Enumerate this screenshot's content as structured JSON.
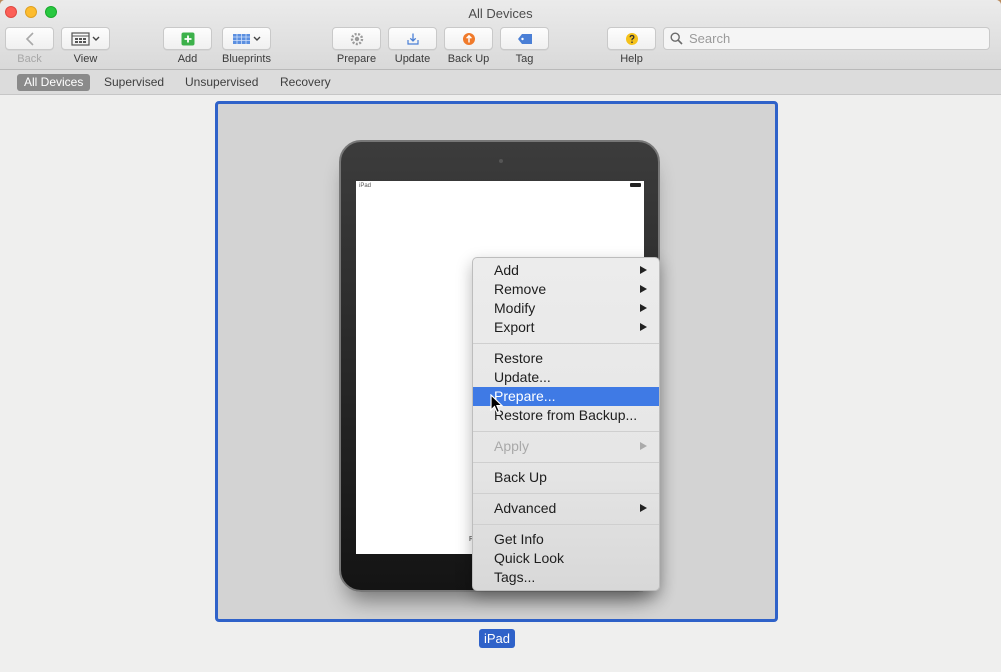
{
  "window": {
    "title": "All Devices"
  },
  "toolbar": {
    "back_label": "Back",
    "view_label": "View",
    "add_label": "Add",
    "blueprints_label": "Blueprints",
    "prepare_label": "Prepare",
    "update_label": "Update",
    "backup_label": "Back Up",
    "tag_label": "Tag",
    "help_label": "Help"
  },
  "search": {
    "placeholder": "Search"
  },
  "scope_tabs": [
    "All Devices",
    "Supervised",
    "Unsupervised",
    "Recovery"
  ],
  "scope_selected": "All Devices",
  "device": {
    "name": "iPad",
    "status_text": "iPad"
  },
  "context_menu": {
    "items": [
      {
        "label": "Add",
        "submenu": true
      },
      {
        "label": "Remove",
        "submenu": true
      },
      {
        "label": "Modify",
        "submenu": true
      },
      {
        "label": "Export",
        "submenu": true
      },
      {
        "label": "Restore"
      },
      {
        "label": "Update..."
      },
      {
        "label": "Prepare...",
        "highlighted": true
      },
      {
        "label": "Restore from Backup..."
      },
      {
        "label": "Apply",
        "submenu": true,
        "disabled": true
      },
      {
        "label": "Back Up"
      },
      {
        "label": "Advanced",
        "submenu": true
      },
      {
        "label": "Get Info"
      },
      {
        "label": "Quick Look"
      },
      {
        "label": "Tags..."
      }
    ]
  },
  "colors": {
    "selection": "#2f62c9",
    "menu_highlight": "#3f7ae5",
    "add_icon": "#3cb14a",
    "backup_icon": "#f07a2b",
    "help_icon": "#f5c21b"
  }
}
